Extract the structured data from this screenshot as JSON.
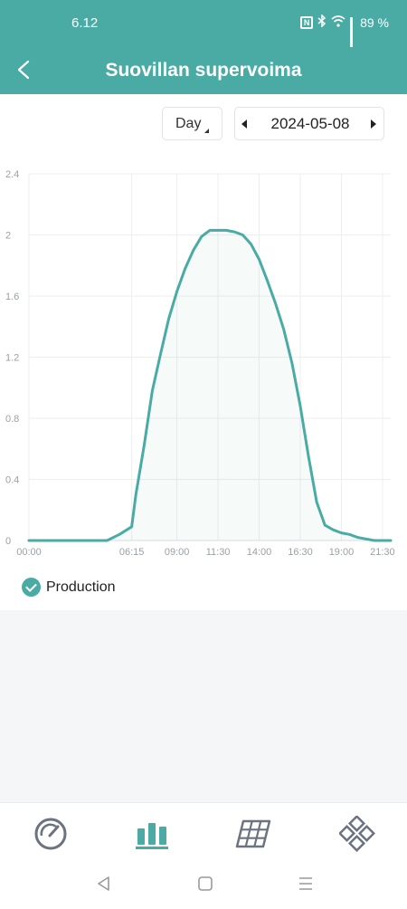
{
  "status_bar": {
    "time": "6.12",
    "battery": "89 %"
  },
  "header": {
    "title": "Suovillan supervoima"
  },
  "controls": {
    "period": "Day",
    "date": "2024-05-08"
  },
  "colors": {
    "accent": "#4aaba5",
    "grid": "#eeeeee",
    "axis_text": "#9aa0a6"
  },
  "chart_data": {
    "type": "area",
    "xlabel": "",
    "ylabel": "",
    "ylim": [
      0,
      2.4
    ],
    "yticks": [
      "0",
      "0.4",
      "0.8",
      "1.2",
      "1.6",
      "2",
      "2.4"
    ],
    "xticks": [
      "00:00",
      "06:15",
      "09:00",
      "11:30",
      "14:00",
      "16:30",
      "19:00",
      "21:30"
    ],
    "series": [
      {
        "name": "Production",
        "x": [
          "00:00",
          "04:45",
          "05:30",
          "06:15",
          "06:30",
          "07:00",
          "07:30",
          "08:00",
          "08:30",
          "09:00",
          "09:30",
          "10:00",
          "10:30",
          "11:00",
          "11:30",
          "12:00",
          "12:30",
          "13:00",
          "13:30",
          "14:00",
          "14:30",
          "15:00",
          "15:30",
          "16:00",
          "16:30",
          "17:00",
          "17:30",
          "18:00",
          "18:30",
          "19:00",
          "19:30",
          "20:00",
          "20:30",
          "21:00",
          "21:30",
          "22:00"
        ],
        "values": [
          0,
          0,
          0.04,
          0.09,
          0.3,
          0.62,
          0.98,
          1.22,
          1.45,
          1.63,
          1.78,
          1.9,
          1.99,
          2.03,
          2.03,
          2.03,
          2.02,
          2.0,
          1.94,
          1.84,
          1.7,
          1.55,
          1.38,
          1.16,
          0.88,
          0.55,
          0.25,
          0.1,
          0.07,
          0.05,
          0.04,
          0.02,
          0.01,
          0,
          0,
          0
        ]
      }
    ],
    "legend": [
      "Production"
    ],
    "grid": true
  },
  "legend": {
    "label": "Production"
  },
  "tabs": [
    {
      "name": "dashboard",
      "icon": "gauge-icon",
      "active": false
    },
    {
      "name": "statistics",
      "icon": "bar-chart-icon",
      "active": true
    },
    {
      "name": "panels",
      "icon": "solar-panel-icon",
      "active": false
    },
    {
      "name": "devices",
      "icon": "grid-diamond-icon",
      "active": false
    }
  ]
}
